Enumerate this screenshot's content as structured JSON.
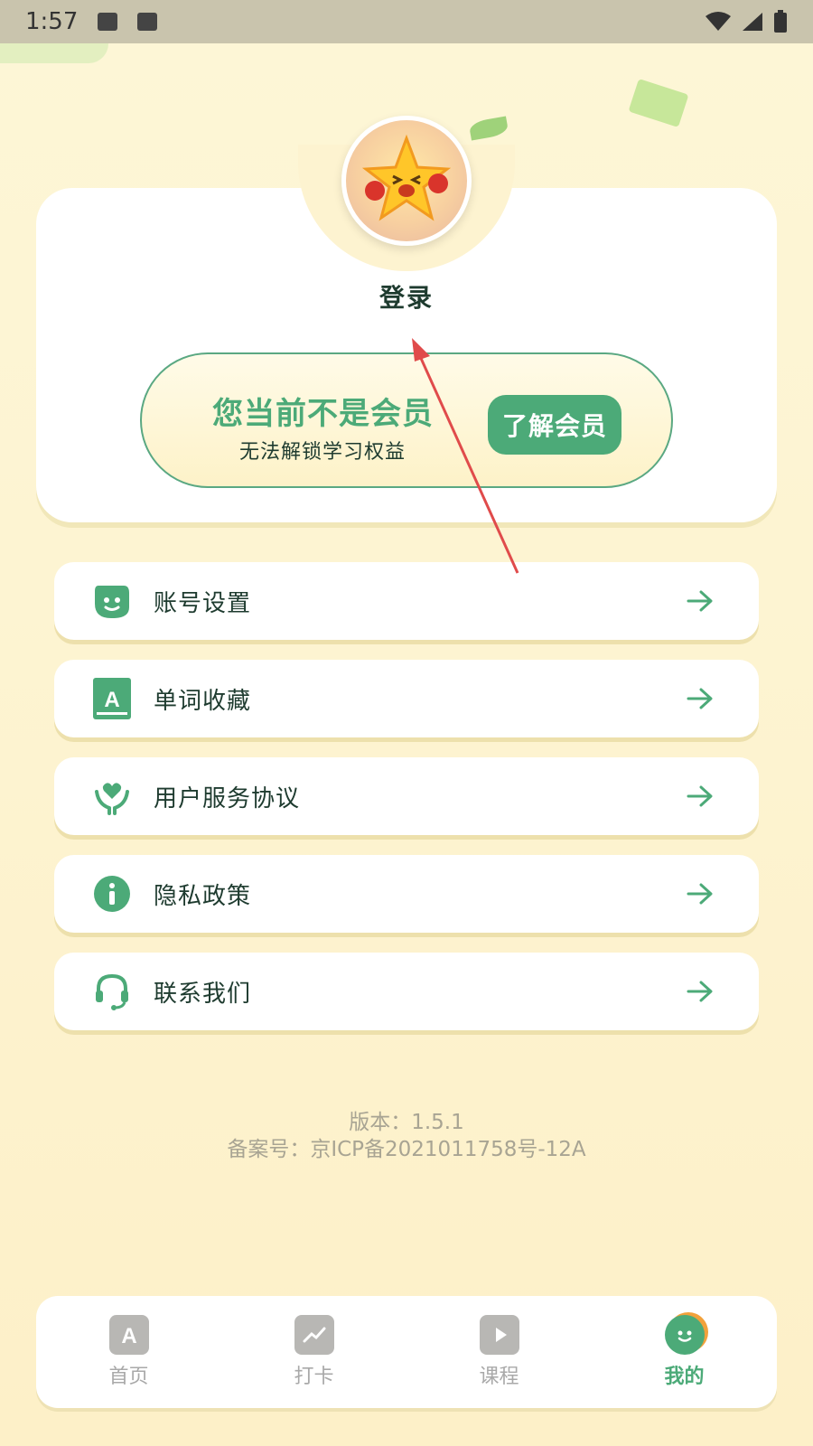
{
  "status_bar": {
    "time": "1:57"
  },
  "profile": {
    "login_label": "登录",
    "member_title": "您当前不是会员",
    "member_subtitle": "无法解锁学习权益",
    "member_button": "了解会员"
  },
  "menu": {
    "items": [
      {
        "label": "账号设置",
        "icon": "face-icon"
      },
      {
        "label": "单词收藏",
        "icon": "word-book-icon"
      },
      {
        "label": "用户服务协议",
        "icon": "heart-hands-icon"
      },
      {
        "label": "隐私政策",
        "icon": "info-icon"
      },
      {
        "label": "联系我们",
        "icon": "headset-icon"
      }
    ]
  },
  "footer": {
    "version": "版本：1.5.1",
    "icp": "备案号：京ICP备2021011758号-12A"
  },
  "tabs": [
    {
      "label": "首页",
      "icon": "home-book-icon",
      "active": false
    },
    {
      "label": "打卡",
      "icon": "checkin-chart-icon",
      "active": false
    },
    {
      "label": "课程",
      "icon": "course-play-icon",
      "active": false
    },
    {
      "label": "我的",
      "icon": "me-face-icon",
      "active": true
    }
  ],
  "colors": {
    "accent": "#4caa78",
    "background": "#fdf4d2",
    "annotation": "#e04b4b"
  }
}
